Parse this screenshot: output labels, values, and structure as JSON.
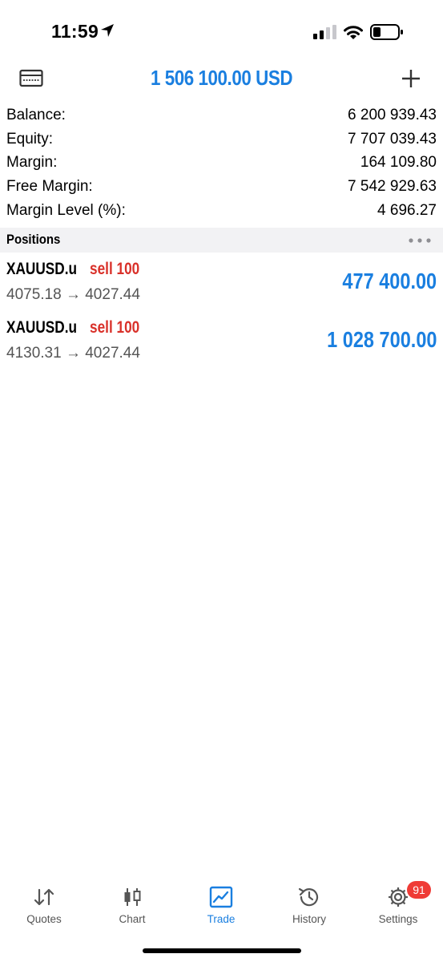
{
  "status_bar": {
    "time": "11:59"
  },
  "header": {
    "title": "1 506 100.00 USD"
  },
  "account": {
    "rows": [
      {
        "label": "Balance:",
        "value": "6 200 939.43"
      },
      {
        "label": "Equity:",
        "value": "7 707 039.43"
      },
      {
        "label": "Margin:",
        "value": "164 109.80"
      },
      {
        "label": "Free Margin:",
        "value": "7 542 929.63"
      },
      {
        "label": "Margin Level (%):",
        "value": "4 696.27"
      }
    ]
  },
  "positions": {
    "title": "Positions",
    "items": [
      {
        "symbol": "XAUUSD.u",
        "type": "sell 100",
        "prices": "4075.18 → 4027.44",
        "profit": "477 400.00"
      },
      {
        "symbol": "XAUUSD.u",
        "type": "sell 100",
        "prices": "4130.31 → 4027.44",
        "profit": "1 028 700.00"
      }
    ]
  },
  "tabs": [
    {
      "label": "Quotes",
      "icon": "quotes-icon"
    },
    {
      "label": "Chart",
      "icon": "chart-icon"
    },
    {
      "label": "Trade",
      "icon": "trade-icon",
      "active": true
    },
    {
      "label": "History",
      "icon": "history-icon"
    },
    {
      "label": "Settings",
      "icon": "settings-icon",
      "badge": "91"
    }
  ],
  "colors": {
    "accent": "#1a7fe0",
    "sell": "#d9312a",
    "badge": "#ef3b36"
  }
}
